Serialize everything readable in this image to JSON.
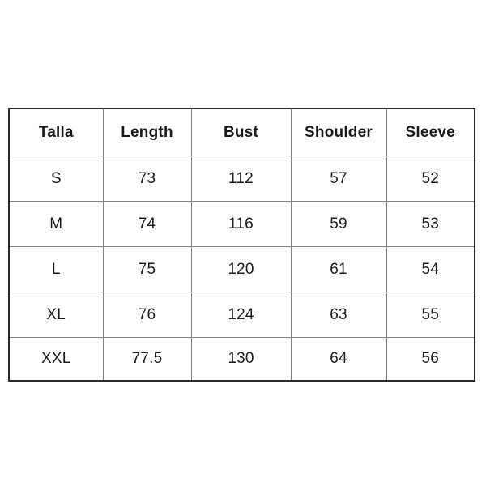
{
  "table": {
    "headers": [
      "Talla",
      "Length",
      "Bust",
      "Shoulder",
      "Sleeve"
    ],
    "rows": [
      {
        "talla": "S",
        "length": "73",
        "bust": "112",
        "shoulder": "57",
        "sleeve": "52"
      },
      {
        "talla": "M",
        "length": "74",
        "bust": "116",
        "shoulder": "59",
        "sleeve": "53"
      },
      {
        "talla": "L",
        "length": "75",
        "bust": "120",
        "shoulder": "61",
        "sleeve": "54"
      },
      {
        "talla": "XL",
        "length": "76",
        "bust": "124",
        "shoulder": "63",
        "sleeve": "55"
      },
      {
        "talla": "XXL",
        "length": "77.5",
        "bust": "130",
        "shoulder": "64",
        "sleeve": "56"
      }
    ]
  },
  "colors": {
    "background": "#ffffff",
    "outer_border": "#2b2b2b",
    "inner_border": "#808080",
    "text": "#1a1a1a"
  }
}
